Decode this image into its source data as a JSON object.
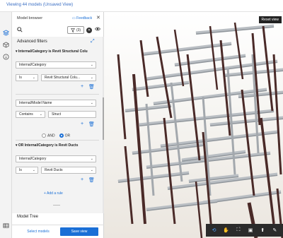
{
  "topbar": {
    "title": "Viewing 44 models (Unsaved View)"
  },
  "rail": {
    "icons": [
      "layers-icon",
      "cube-icon",
      "info-icon",
      "table-icon"
    ]
  },
  "panel": {
    "title": "Model browser",
    "feedback": "Feedback",
    "filter_label": "(3)",
    "advanced_title": "Advanced filters",
    "groups": [
      {
        "header": "Internal/Category is Revit Structural Colu",
        "property": "Internal/Category",
        "operator": "Is",
        "value": "Revit Structural Colu..."
      },
      {
        "property": "Internal/Model Name",
        "operator": "Contains",
        "value": "Struct"
      },
      {
        "header": "OR Internal/Category is Revit Ducts",
        "property": "Internal/Category",
        "operator": "Is",
        "value": "Revit Ducts"
      }
    ],
    "logic": {
      "and": "AND",
      "or": "OR",
      "selected": "OR"
    },
    "add_rule": "Add a rule",
    "model_tree": "Model Tree",
    "select_models": "Select models",
    "save_view": "Save view"
  },
  "viewport": {
    "reset_view": "Reset view",
    "nav_icons": [
      "orbit-icon",
      "pan-icon",
      "fit-icon",
      "section-icon",
      "walk-icon",
      "settings-icon"
    ]
  },
  "colors": {
    "accent": "#1a6fd6",
    "column": "#4a2a28",
    "duct": "#b9bec3"
  }
}
